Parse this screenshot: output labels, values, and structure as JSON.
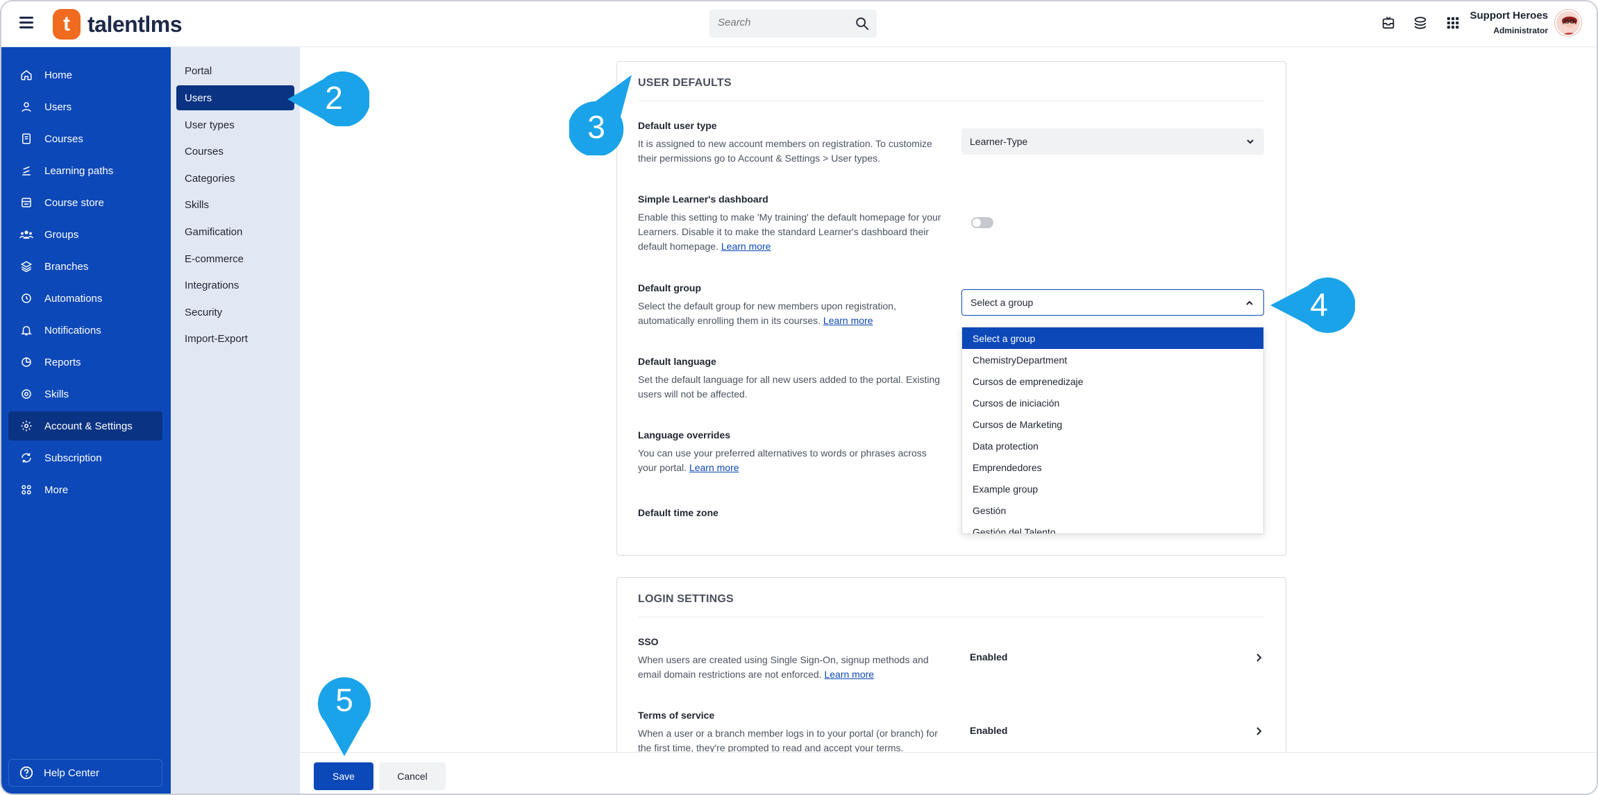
{
  "header": {
    "brand": "talentlms",
    "brand_letter": "t",
    "search_placeholder": "Search",
    "user_name": "Support Heroes",
    "user_role": "Administrator"
  },
  "sidebar": {
    "items": [
      {
        "label": "Home",
        "icon": "home-icon"
      },
      {
        "label": "Users",
        "icon": "user-icon"
      },
      {
        "label": "Courses",
        "icon": "book-icon"
      },
      {
        "label": "Learning paths",
        "icon": "path-icon"
      },
      {
        "label": "Course store",
        "icon": "store-icon"
      },
      {
        "label": "Groups",
        "icon": "group-icon"
      },
      {
        "label": "Branches",
        "icon": "layers-icon"
      },
      {
        "label": "Automations",
        "icon": "automation-icon"
      },
      {
        "label": "Notifications",
        "icon": "bell-icon"
      },
      {
        "label": "Reports",
        "icon": "pie-chart-icon"
      },
      {
        "label": "Skills",
        "icon": "skills-icon"
      },
      {
        "label": "Account & Settings",
        "icon": "gear-icon"
      },
      {
        "label": "Subscription",
        "icon": "subscription-icon"
      },
      {
        "label": "More",
        "icon": "grid-dots-icon"
      }
    ],
    "active_index": 11,
    "help_center": "Help Center"
  },
  "subnav": {
    "items": [
      "Portal",
      "Users",
      "User types",
      "Courses",
      "Categories",
      "Skills",
      "Gamification",
      "E-commerce",
      "Integrations",
      "Security",
      "Import-Export"
    ],
    "active_index": 1
  },
  "user_defaults": {
    "title": "USER DEFAULTS",
    "default_user_type": {
      "title": "Default user type",
      "desc": "It is assigned to new account members on registration. To customize their permissions go to Account & Settings > User types.",
      "value": "Learner-Type"
    },
    "simple_dashboard": {
      "title": "Simple Learner's dashboard",
      "desc": "Enable this setting to make 'My training' the default homepage for your Learners. Disable it to make the standard Learner's dashboard their default homepage.",
      "link": "Learn more",
      "enabled": false
    },
    "default_group": {
      "title": "Default group",
      "desc": "Select the default group for new members upon registration, automatically enrolling them in its courses.",
      "link": "Learn more",
      "value": "Select a group",
      "options": [
        "Select a group",
        "ChemistryDepartment",
        "Cursos de emprenedizaje",
        "Cursos de iniciación",
        "Cursos de Marketing",
        "Data protection",
        "Emprendedores",
        "Example group",
        "Gestión",
        "Gestión del Talento"
      ]
    },
    "default_language": {
      "title": "Default language",
      "desc": "Set the default language for all new users added to the portal. Existing users will not be affected."
    },
    "language_overrides": {
      "title": "Language overrides",
      "desc": "You can use your preferred alternatives to words or phrases across your portal.",
      "link": "Learn more"
    },
    "default_time_zone": {
      "title": "Default time zone"
    }
  },
  "login_settings": {
    "title": "LOGIN SETTINGS",
    "sso": {
      "title": "SSO",
      "desc": "When users are created using Single Sign-On, signup methods and email domain restrictions are not enforced.",
      "link": "Learn more",
      "value": "Enabled"
    },
    "terms": {
      "title": "Terms of service",
      "desc": "When a user or a branch member logs in to your portal (or branch) for the first time, they're prompted to read and accept your terms.",
      "value": "Enabled"
    }
  },
  "footer": {
    "save": "Save",
    "cancel": "Cancel"
  },
  "callouts": [
    "2",
    "3",
    "4",
    "5"
  ],
  "colors": {
    "sidebar": "#0c48b8",
    "sidebar_active": "#0b3383",
    "accent": "#0c48b8",
    "callout": "#1aa3e8",
    "logo": "#f06b1f"
  }
}
